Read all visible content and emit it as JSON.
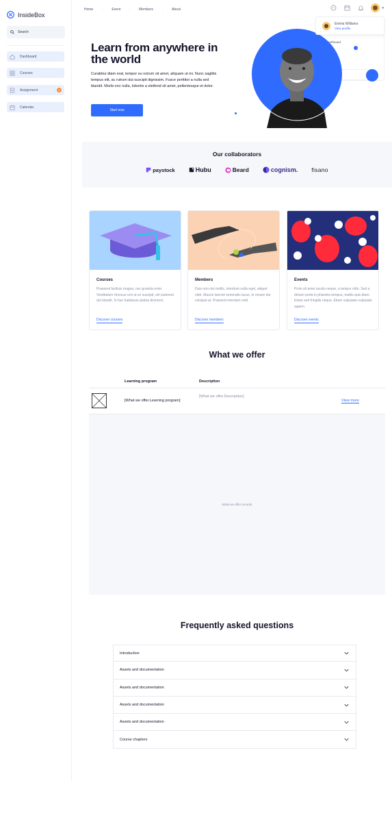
{
  "app": {
    "name": "InsideBox"
  },
  "search": {
    "label": "Search"
  },
  "sidebar": {
    "items": [
      {
        "label": "Dashboard",
        "icon": "home-icon"
      },
      {
        "label": "Courses",
        "icon": "grid-icon"
      },
      {
        "label": "Assignment",
        "icon": "assignment-icon",
        "badge": "8"
      },
      {
        "label": "Calendar",
        "icon": "calendar-icon"
      }
    ]
  },
  "nav": {
    "links": [
      "Home",
      "Event",
      "Members",
      "About"
    ]
  },
  "profile": {
    "name": "Emma Williams",
    "link": "View profile"
  },
  "dashboard_card": {
    "label": "Dashboard"
  },
  "hero": {
    "title": "Learn from anywhere in the world",
    "text": "Curabitur diam erat, tempor eu rutrum sit amet, aliquam ut mi. Nunc sagittis tempus elit, ac rutrum dui suscipit dignissim. Fusce porttitor a nulla sed blandit. Morbi orci nulla, lobortis a eleifend sit amet, pellentesque et dolor.",
    "button": "Start now"
  },
  "collaborators": {
    "title": "Our collaborators",
    "logos": [
      "paystock",
      "Hubu",
      "Beard",
      "cognism.",
      "fisano"
    ]
  },
  "cards": [
    {
      "title": "Courses",
      "desc": "Praesent facilisis magna, nec gravida enim. Vestibulum rhoncus orci ut ex suscipit, vel euismod dui blandit. In hac habitasse platea dictumst.",
      "link": "Discover courses"
    },
    {
      "title": "Members",
      "desc": "Duis non nisi mollis, interdum nulla eget, aliquet nibh. Mauris laoreet venenatis lacus, in ornare dui volutpat at. Praesent interdum velit.",
      "link": "Discover members"
    },
    {
      "title": "Events",
      "desc": "Proin sit amet iaculis neque, a tempor nibh. Sed a dictum porta in pharetra tempus, mattis quis diam. Etiam sed fringilla neque. Etiam vulputate vulputate sapien.",
      "link": "Discover events"
    }
  ],
  "offer": {
    "title": "What we offer",
    "headers": {
      "program": "Learning program",
      "description": "Description"
    },
    "row": {
      "program": "[What we offer.Learning program]",
      "description": "[What we offer.Description]",
      "link": "View more"
    },
    "records_label": "What we offer records"
  },
  "faq": {
    "title": "Frequently asked questions",
    "items": [
      "Introduction",
      "Assets and documentation",
      "Assets and documentation",
      "Assets and documentation",
      "Assets and documentation",
      "Course chapters"
    ]
  },
  "colors": {
    "accent": "#2f6bff",
    "badge": "#ff8a34",
    "sidebar_item_bg": "#e9f0fd",
    "section_bg": "#f5f7fa"
  }
}
